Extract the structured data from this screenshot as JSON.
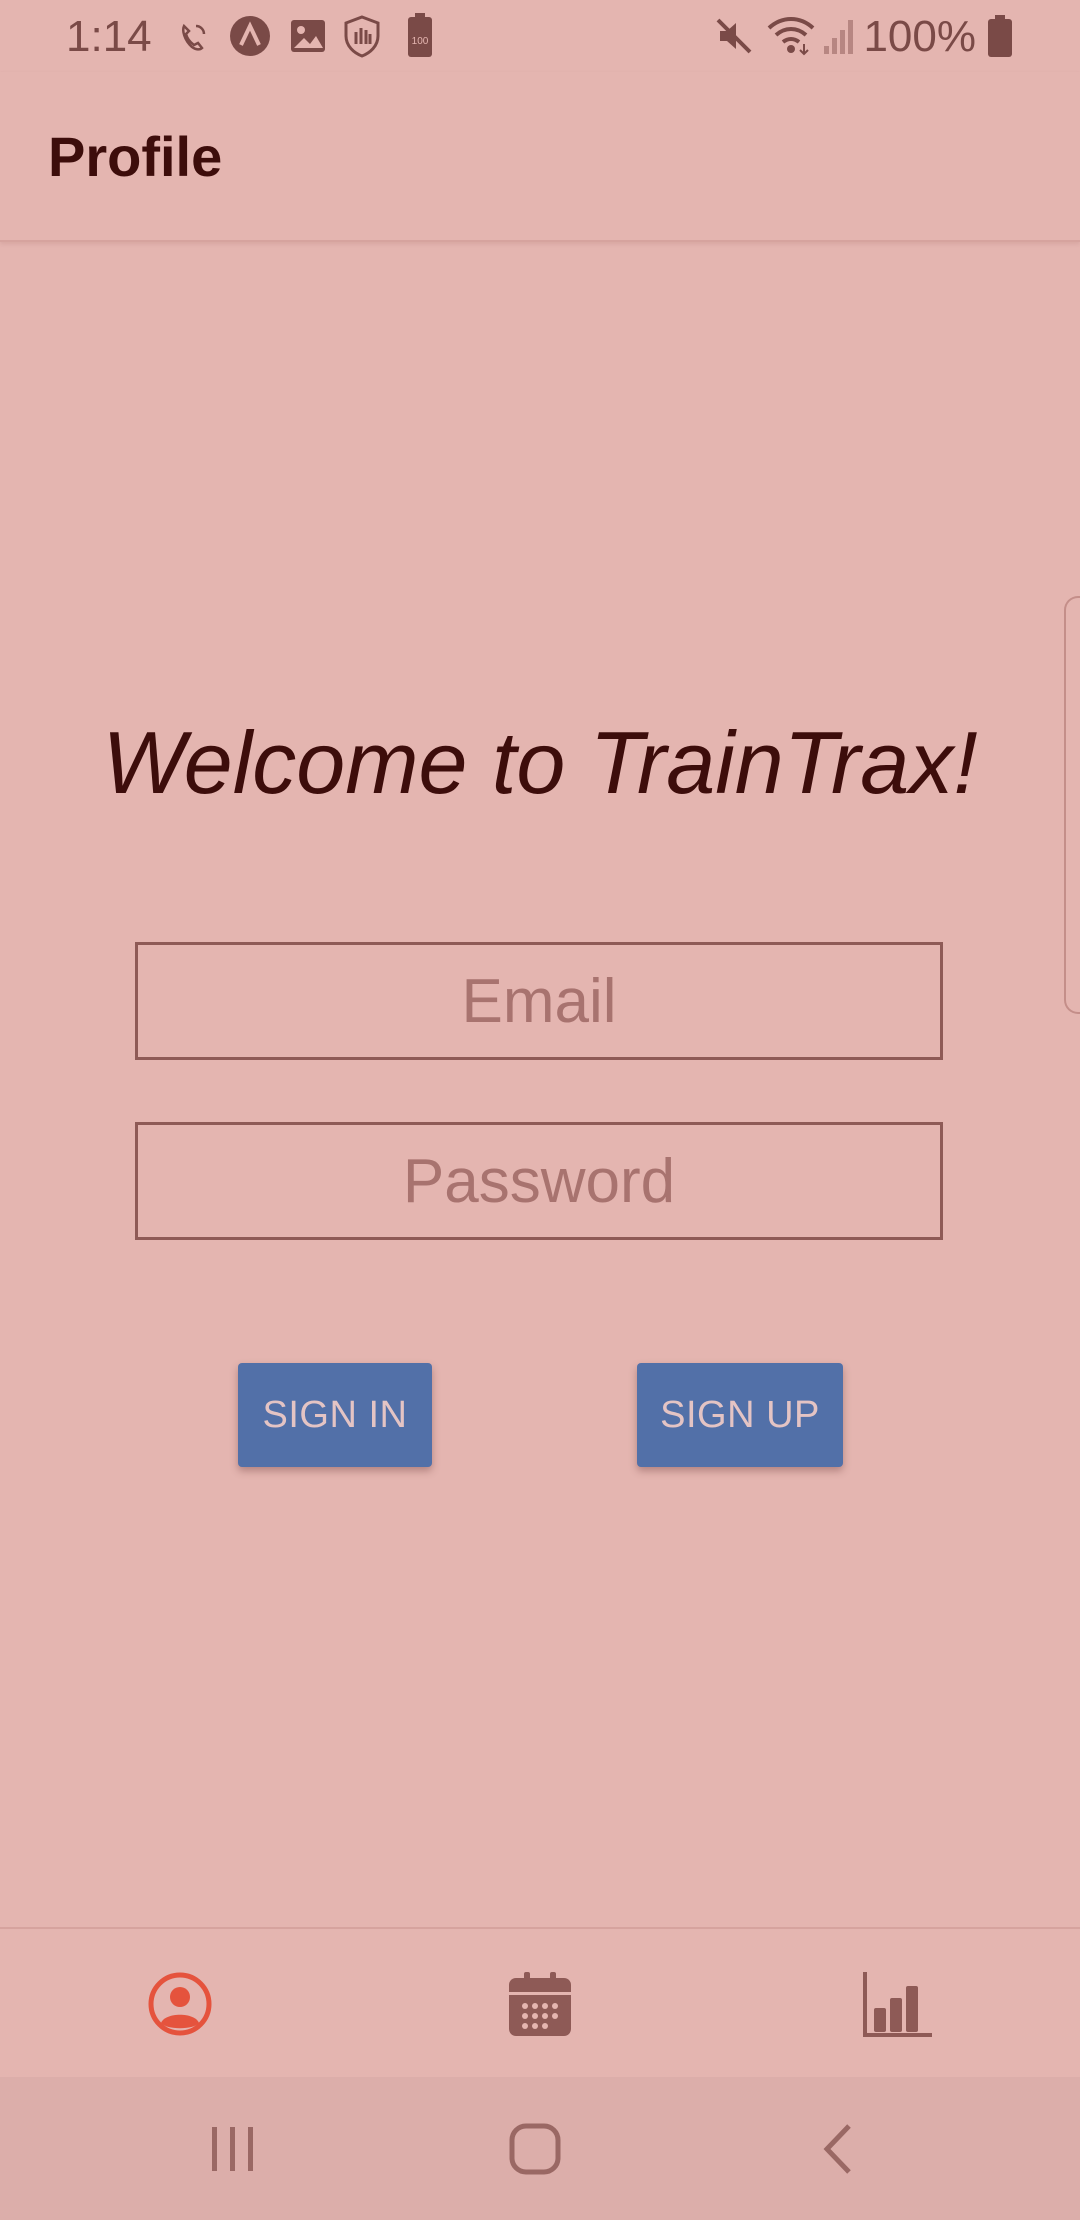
{
  "status_bar": {
    "time": "1:14",
    "battery_text": "100%",
    "battery_small_label": "100",
    "icons": [
      "wifi-call-icon",
      "a-circle-icon",
      "image-icon",
      "shield-hand-icon",
      "battery-100-icon",
      "mute-icon",
      "wifi-icon",
      "signal-icon",
      "battery-icon"
    ]
  },
  "app_bar": {
    "title": "Profile"
  },
  "main": {
    "welcome": "Welcome to TrainTrax!",
    "email_placeholder": "Email",
    "password_placeholder": "Password",
    "signin_label": "SIGN IN",
    "signup_label": "SIGN UP"
  },
  "bottom_nav": {
    "items": [
      {
        "icon": "account-circle-icon",
        "active": true
      },
      {
        "icon": "calendar-icon",
        "active": false
      },
      {
        "icon": "bar-chart-icon",
        "active": false
      }
    ]
  },
  "colors": {
    "background": "#e4b5b0",
    "text_dark": "#3d0d0b",
    "button": "#5270a8",
    "active_nav": "#e5533d",
    "inactive_nav": "#8e5a56"
  }
}
